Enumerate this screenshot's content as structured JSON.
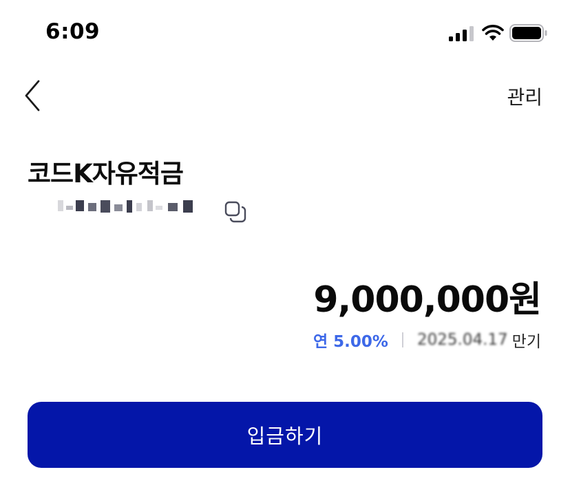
{
  "status_bar": {
    "time": "6:09",
    "icons": [
      "signal-icon",
      "wifi-icon",
      "battery-icon"
    ]
  },
  "nav": {
    "back_icon": "chevron-left-icon",
    "manage_label": "관리"
  },
  "account": {
    "title": "코드K자유적금",
    "number_masked": true,
    "copy_icon": "copy-icon"
  },
  "balance": {
    "amount": "9,000,000원"
  },
  "details": {
    "rate": "연 5.00%",
    "maturity_date": "2025.04.17",
    "maturity_label": "만기"
  },
  "actions": {
    "deposit_label": "입금하기"
  },
  "colors": {
    "primary_button": "#0416a9",
    "rate_accent": "#3d68e8",
    "text": "#111111",
    "background": "#ffffff"
  }
}
